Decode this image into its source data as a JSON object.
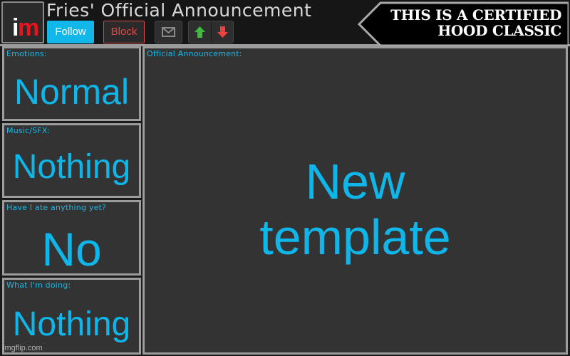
{
  "header": {
    "logo": {
      "letter_i": "i",
      "letter_m": "m",
      "i_color": "#ffffff",
      "m_color": "#e8141b"
    },
    "title": "Fries' Official  Announcement",
    "buttons": {
      "follow_label": "Follow",
      "block_label": "Block",
      "mail_icon": "envelope-icon",
      "upvote_icon": "arrow-up-icon",
      "downvote_icon": "arrow-down-icon"
    },
    "banner": {
      "line1": "THIS IS A CERTIFIED",
      "line2": "HOOD CLASSIC"
    }
  },
  "panels": {
    "emotions": {
      "label": "Emotions:",
      "value": "Normal"
    },
    "music": {
      "label": "Music/SFX:",
      "value": "Nothing"
    },
    "ate": {
      "label": "Have I ate anything yet?",
      "value": "No"
    },
    "doing": {
      "label": "What I'm doing:",
      "value": "Nothing"
    },
    "announcement": {
      "label": "Official Announcement:",
      "value_line1": "New",
      "value_line2": "template"
    }
  },
  "watermark": "imgflip.com",
  "colors": {
    "accent": "#0fb6ea",
    "follow_bg": "#11b7e8",
    "block_red": "#e04848",
    "upvote_green": "#3dbb3d",
    "downvote_red": "#f04040",
    "panel_bg": "#333333",
    "panel_border": "#9c9c9c"
  }
}
